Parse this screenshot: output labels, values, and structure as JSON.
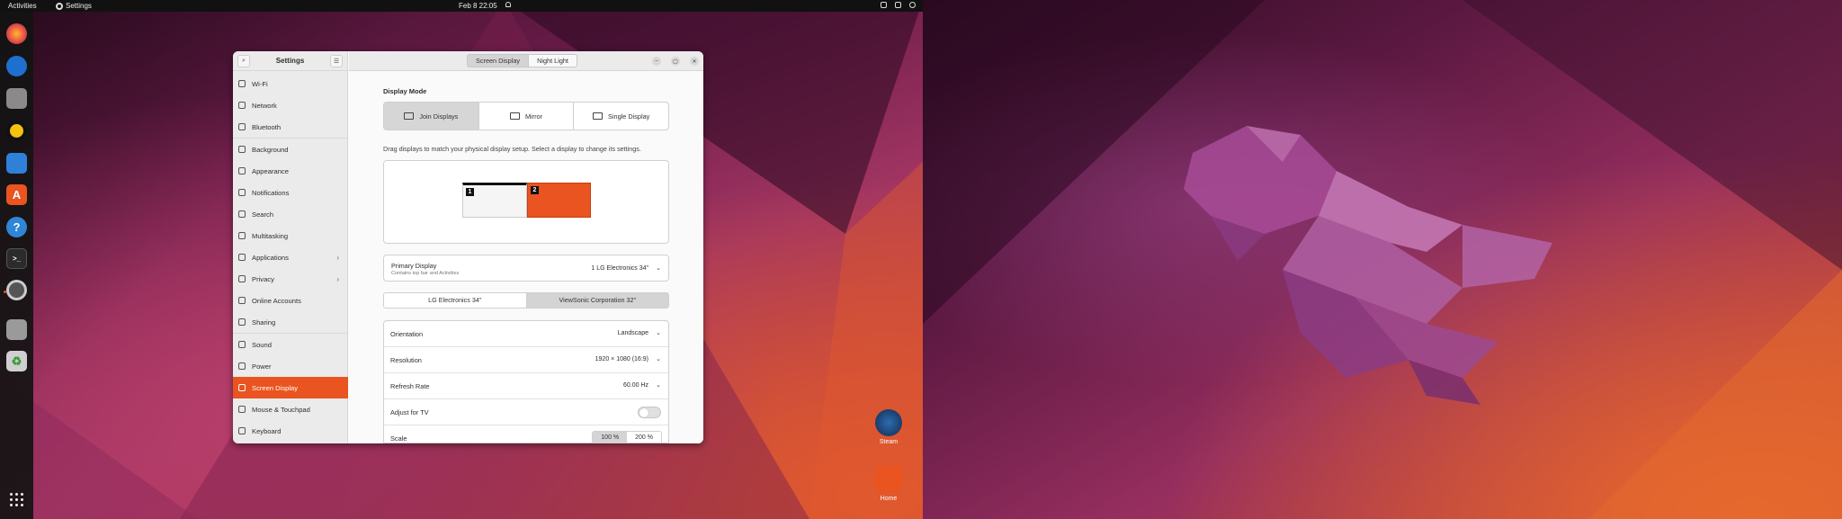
{
  "topbar": {
    "activities": "Activities",
    "app_name": "Settings",
    "clock": "Feb 8  22:05"
  },
  "dock": {
    "items": [
      "firefox-icon",
      "thunderbird-icon",
      "files-icon",
      "rhythmbox-icon",
      "writer-icon",
      "software-icon",
      "help-icon",
      "terminal-icon",
      "settings-icon",
      "drive-icon",
      "trash-icon"
    ],
    "apps_grid": "show-apps-icon"
  },
  "desktop": {
    "steam_label": "Steam",
    "home_label": "Home"
  },
  "sidebar": {
    "title": "Settings",
    "items": [
      {
        "label": "Wi-Fi"
      },
      {
        "label": "Network"
      },
      {
        "label": "Bluetooth"
      },
      {
        "label": "Background"
      },
      {
        "label": "Appearance"
      },
      {
        "label": "Notifications"
      },
      {
        "label": "Search"
      },
      {
        "label": "Multitasking"
      },
      {
        "label": "Applications"
      },
      {
        "label": "Privacy"
      },
      {
        "label": "Online Accounts"
      },
      {
        "label": "Sharing"
      },
      {
        "label": "Sound"
      },
      {
        "label": "Power"
      },
      {
        "label": "Screen Display"
      },
      {
        "label": "Mouse & Touchpad"
      },
      {
        "label": "Keyboard"
      }
    ]
  },
  "header": {
    "tabs": [
      "Screen Display",
      "Night Light"
    ]
  },
  "display": {
    "mode_label": "Display Mode",
    "modes": [
      "Join Displays",
      "Mirror",
      "Single Display"
    ],
    "hint": "Drag displays to match your physical display setup. Select a display to change its settings.",
    "monitor_1": "1",
    "monitor_2": "2",
    "primary_title": "Primary Display",
    "primary_sub": "Contains top bar and Activities",
    "primary_value": "1   LG Electronics 34\"",
    "monitor_tabs": [
      "LG Electronics 34\"",
      "ViewSonic Corporation 32\""
    ],
    "rows": {
      "orientation": {
        "label": "Orientation",
        "value": "Landscape"
      },
      "resolution": {
        "label": "Resolution",
        "value": "1920 × 1080 (16:9)"
      },
      "refresh": {
        "label": "Refresh Rate",
        "value": "60.00 Hz"
      },
      "adjust_tv": {
        "label": "Adjust for TV"
      },
      "scale": {
        "label": "Scale",
        "options": [
          "100 %",
          "200 %"
        ]
      }
    }
  },
  "colors": {
    "accent": "#e95420",
    "sidebar_bg": "#ebebeb",
    "topbar_bg": "#111111"
  }
}
